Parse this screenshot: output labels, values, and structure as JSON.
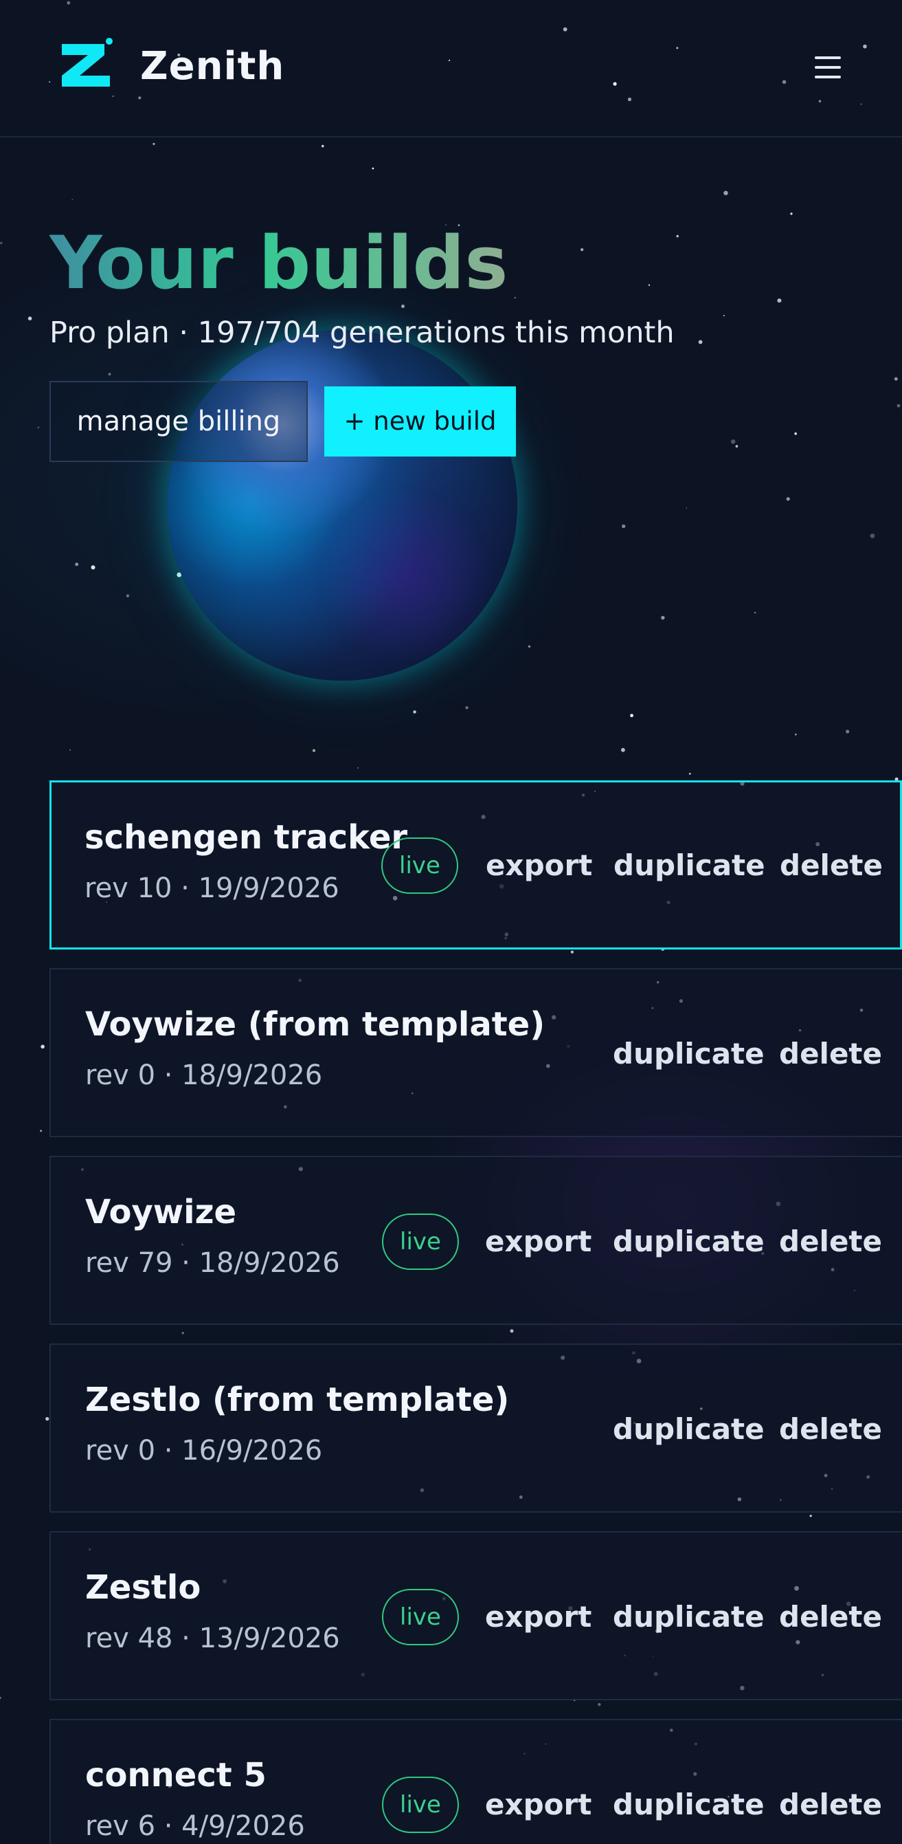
{
  "header": {
    "brand_name": "Zenith",
    "logo_icon": "zenith-logo-icon",
    "menu_icon": "hamburger-menu-icon"
  },
  "hero": {
    "title": "Your builds",
    "subtitle": "Pro plan · 197/704 generations this month",
    "manage_billing_label": "manage billing",
    "new_build_label": "+ new build"
  },
  "builds": [
    {
      "name": "schengen tracker",
      "meta": "rev 10 · 19/9/2026",
      "live": true,
      "status_label": "live",
      "export_label": "export",
      "duplicate_label": "duplicate",
      "delete_label": "delete",
      "selected": true
    },
    {
      "name": "Voywize (from template)",
      "meta": "rev 0 · 18/9/2026",
      "live": false,
      "status_label": "",
      "export_label": "",
      "duplicate_label": "duplicate",
      "delete_label": "delete",
      "selected": false
    },
    {
      "name": "Voywize",
      "meta": "rev 79 · 18/9/2026",
      "live": true,
      "status_label": "live",
      "export_label": "export",
      "duplicate_label": "duplicate",
      "delete_label": "delete",
      "selected": false
    },
    {
      "name": "Zestlo (from template)",
      "meta": "rev 0 · 16/9/2026",
      "live": false,
      "status_label": "",
      "export_label": "",
      "duplicate_label": "duplicate",
      "delete_label": "delete",
      "selected": false
    },
    {
      "name": "Zestlo",
      "meta": "rev 48 · 13/9/2026",
      "live": true,
      "status_label": "live",
      "export_label": "export",
      "duplicate_label": "duplicate",
      "delete_label": "delete",
      "selected": false
    },
    {
      "name": "connect 5",
      "meta": "rev 6 · 4/9/2026",
      "live": true,
      "status_label": "live",
      "export_label": "export",
      "duplicate_label": "duplicate",
      "delete_label": "delete",
      "selected": false
    }
  ],
  "colors": {
    "accent": "#10f0ff",
    "live_badge": "#2fc982",
    "background": "#0c1424"
  }
}
